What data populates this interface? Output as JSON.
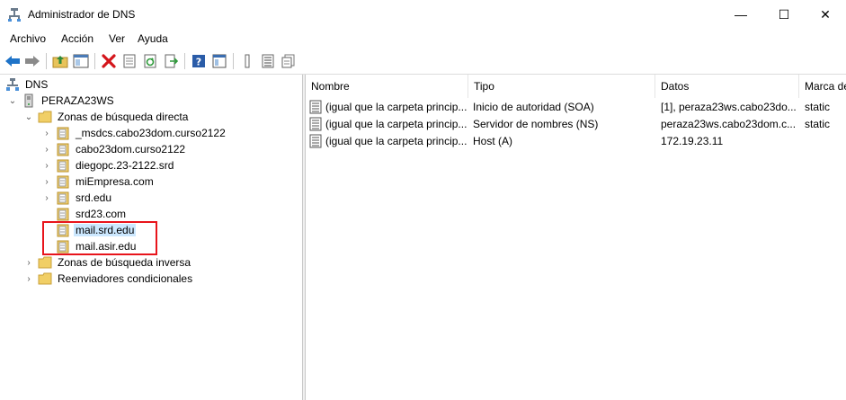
{
  "window": {
    "title": "Administrador de DNS",
    "minimize": "—",
    "maximize": "☐",
    "close": "✕"
  },
  "menu": [
    "Archivo",
    "Acción",
    "Ver",
    "Ayuda"
  ],
  "toolbar_icons": [
    "back-icon",
    "forward-icon",
    "up-folder-icon",
    "show-hide-tree-icon",
    "delete-icon",
    "properties-icon",
    "refresh-icon",
    "export-list-icon",
    "help-icon",
    "console-icon",
    "columns-icon",
    "list-icon",
    "records-icon"
  ],
  "tree": {
    "root": "DNS",
    "server": "PERAZA23WS",
    "forward_zones": "Zonas de búsqueda directa",
    "zones": [
      "_msdcs.cabo23dom.curso2122",
      "cabo23dom.curso2122",
      "diegopc.23-2122.srd",
      "miEmpresa.com",
      "srd.edu",
      "srd23.com",
      "mail.srd.edu",
      "mail.asir.edu"
    ],
    "reverse_zones": "Zonas de búsqueda inversa",
    "conditional_forwarders": "Reenviadores condicionales",
    "selected": "mail.srd.edu"
  },
  "list": {
    "columns": [
      "Nombre",
      "Tipo",
      "Datos",
      "Marca de"
    ],
    "rows": [
      {
        "name": "(igual que la carpeta princip...",
        "type": "Inicio de autoridad (SOA)",
        "data": "[1], peraza23ws.cabo23do...",
        "stamp": "static"
      },
      {
        "name": "(igual que la carpeta princip...",
        "type": "Servidor de nombres (NS)",
        "data": "peraza23ws.cabo23dom.c...",
        "stamp": "static"
      },
      {
        "name": "(igual que la carpeta princip...",
        "type": "Host (A)",
        "data": "172.19.23.11",
        "stamp": ""
      }
    ]
  },
  "colors": {
    "selection": "#cce8ff",
    "highlight_border": "#e8141b",
    "folder": "#e8c35a"
  }
}
